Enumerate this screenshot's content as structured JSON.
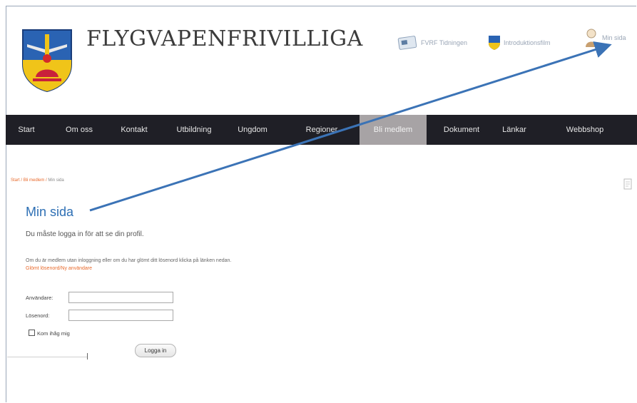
{
  "header": {
    "site_title": "FLYGVAPENFRIVILLIGA",
    "links": [
      {
        "label": "FVRF Tidningen",
        "icon": "newspaper-icon"
      },
      {
        "label": "Introduktionsfilm",
        "icon": "crest-small-icon"
      },
      {
        "label": "Min sida",
        "icon": "user-profile-icon"
      }
    ]
  },
  "nav": {
    "items": [
      "Start",
      "Om oss",
      "Kontakt",
      "Utbildning",
      "Ungdom",
      "Regioner",
      "Bli medlem",
      "Dokument",
      "Länkar",
      "Webbshop"
    ],
    "active": "Bli medlem"
  },
  "breadcrumb": {
    "start": "Start",
    "section": "Bli medlem",
    "current": "Min sida"
  },
  "main": {
    "title": "Min sida",
    "login_required": "Du måste logga in för att se din profil.",
    "info_text": "Om du är medlem utan inloggning eller om du har glömt ditt lösenord klicka på länken nedan.",
    "forgot_link": "Glömt lösenord/Ny användare",
    "username_label": "Användare:",
    "password_label": "Lösenord:",
    "username_value": "",
    "password_value": "",
    "remember_label": "Kom ihåg mig",
    "login_button": "Logga in"
  },
  "colors": {
    "nav_bg": "#1f1f26",
    "nav_active": "#a7a3a5",
    "title_blue": "#2d6fb4",
    "link_orange": "#e86a2c",
    "annotation_arrow": "#3b73b6"
  }
}
